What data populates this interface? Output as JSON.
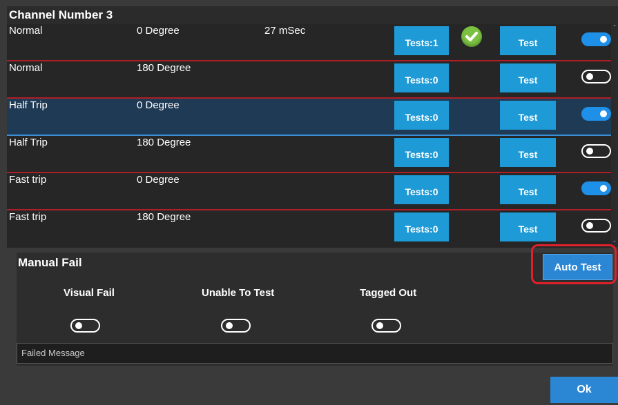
{
  "header": {
    "title": "Channel Number  3"
  },
  "rows": [
    {
      "name": "Normal",
      "degree": "0 Degree",
      "time": "27 mSec",
      "tests_label": "Tests:1",
      "test_label": "Test",
      "passed": true,
      "enabled": true,
      "selected": false
    },
    {
      "name": "Normal",
      "degree": "180 Degree",
      "time": "",
      "tests_label": "Tests:0",
      "test_label": "Test",
      "passed": false,
      "enabled": false,
      "selected": false
    },
    {
      "name": "Half Trip",
      "degree": "0 Degree",
      "time": "",
      "tests_label": "Tests:0",
      "test_label": "Test",
      "passed": false,
      "enabled": true,
      "selected": true
    },
    {
      "name": "Half Trip",
      "degree": "180 Degree",
      "time": "",
      "tests_label": "Tests:0",
      "test_label": "Test",
      "passed": false,
      "enabled": false,
      "selected": false
    },
    {
      "name": "Fast trip",
      "degree": "0 Degree",
      "time": "",
      "tests_label": "Tests:0",
      "test_label": "Test",
      "passed": false,
      "enabled": true,
      "selected": false
    },
    {
      "name": "Fast trip",
      "degree": "180 Degree",
      "time": "",
      "tests_label": "Tests:0",
      "test_label": "Test",
      "passed": false,
      "enabled": false,
      "selected": false
    }
  ],
  "manual": {
    "title": "Manual Fail",
    "visual_fail": "Visual Fail",
    "unable_to_test": "Unable To Test",
    "tagged_out": "Tagged Out",
    "visual_fail_on": false,
    "unable_to_test_on": false,
    "tagged_out_on": false,
    "failed_message_placeholder": "Failed Message"
  },
  "buttons": {
    "auto_test": "Auto Test",
    "ok": "Ok"
  },
  "colors": {
    "accent": "#1e9ad6",
    "toggle_on": "#1e90e8",
    "highlight": "#e0202a",
    "row_divider": "#b01e26",
    "check": "#7cc242"
  }
}
